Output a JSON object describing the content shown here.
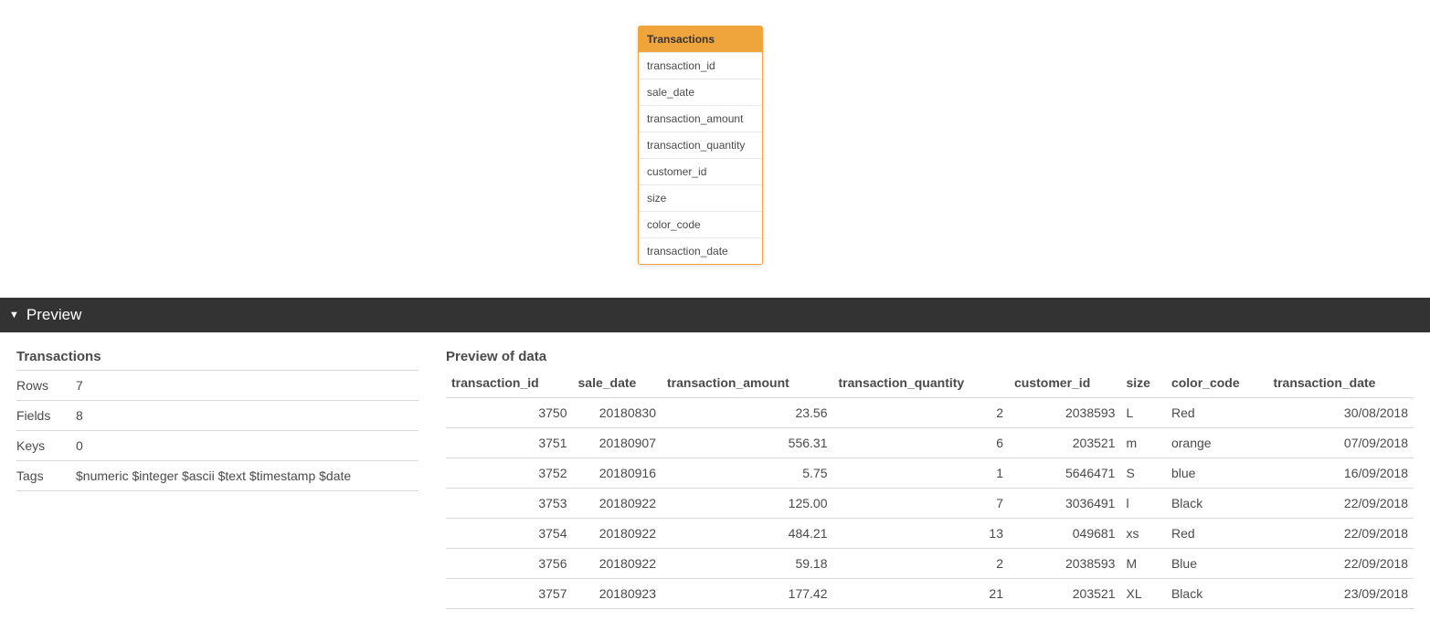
{
  "entity": {
    "name": "Transactions",
    "fields": [
      "transaction_id",
      "sale_date",
      "transaction_amount",
      "transaction_quantity",
      "customer_id",
      "size",
      "color_code",
      "transaction_date"
    ]
  },
  "previewBar": {
    "label": "Preview"
  },
  "meta": {
    "title": "Transactions",
    "rowsLabel": "Rows",
    "rowsValue": "7",
    "fieldsLabel": "Fields",
    "fieldsValue": "8",
    "keysLabel": "Keys",
    "keysValue": "0",
    "tagsLabel": "Tags",
    "tagsValue": "$numeric $integer $ascii $text $timestamp $date"
  },
  "preview": {
    "title": "Preview of data",
    "columns": [
      {
        "key": "transaction_id",
        "label": "transaction_id",
        "align": "num"
      },
      {
        "key": "sale_date",
        "label": "sale_date",
        "align": "num"
      },
      {
        "key": "transaction_amount",
        "label": "transaction_amount",
        "align": "num"
      },
      {
        "key": "transaction_quantity",
        "label": "transaction_quantity",
        "align": "num"
      },
      {
        "key": "customer_id",
        "label": "customer_id",
        "align": "num"
      },
      {
        "key": "size",
        "label": "size",
        "align": "txt"
      },
      {
        "key": "color_code",
        "label": "color_code",
        "align": "txt"
      },
      {
        "key": "transaction_date",
        "label": "transaction_date",
        "align": "num"
      }
    ],
    "rows": [
      {
        "transaction_id": "3750",
        "sale_date": "20180830",
        "transaction_amount": "23.56",
        "transaction_quantity": "2",
        "customer_id": "2038593",
        "size": "L",
        "color_code": "Red",
        "transaction_date": "30/08/2018"
      },
      {
        "transaction_id": "3751",
        "sale_date": "20180907",
        "transaction_amount": "556.31",
        "transaction_quantity": "6",
        "customer_id": "203521",
        "size": "m",
        "color_code": "orange",
        "transaction_date": "07/09/2018"
      },
      {
        "transaction_id": "3752",
        "sale_date": "20180916",
        "transaction_amount": "5.75",
        "transaction_quantity": "1",
        "customer_id": "5646471",
        "size": "S",
        "color_code": "blue",
        "transaction_date": "16/09/2018"
      },
      {
        "transaction_id": "3753",
        "sale_date": "20180922",
        "transaction_amount": "125.00",
        "transaction_quantity": "7",
        "customer_id": "3036491",
        "size": "l",
        "color_code": "Black",
        "transaction_date": "22/09/2018"
      },
      {
        "transaction_id": "3754",
        "sale_date": "20180922",
        "transaction_amount": "484.21",
        "transaction_quantity": "13",
        "customer_id": "049681",
        "size": "xs",
        "color_code": "Red",
        "transaction_date": "22/09/2018"
      },
      {
        "transaction_id": "3756",
        "sale_date": "20180922",
        "transaction_amount": "59.18",
        "transaction_quantity": "2",
        "customer_id": "2038593",
        "size": "M",
        "color_code": "Blue",
        "transaction_date": "22/09/2018"
      },
      {
        "transaction_id": "3757",
        "sale_date": "20180923",
        "transaction_amount": "177.42",
        "transaction_quantity": "21",
        "customer_id": "203521",
        "size": "XL",
        "color_code": "Black",
        "transaction_date": "23/09/2018"
      }
    ]
  }
}
